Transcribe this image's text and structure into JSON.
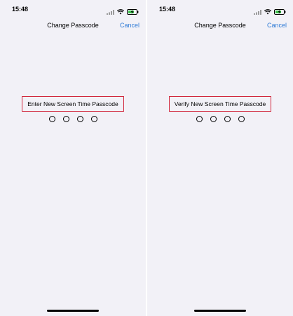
{
  "screens": [
    {
      "status_time": "15:48",
      "nav_title": "Change Passcode",
      "cancel_label": "Cancel",
      "prompt": "Enter New Screen Time Passcode",
      "passcode_dots_filled": 0,
      "passcode_length": 4
    },
    {
      "status_time": "15:48",
      "nav_title": "Change Passcode",
      "cancel_label": "Cancel",
      "prompt": "Verify New Screen Time Passcode",
      "passcode_dots_filled": 0,
      "passcode_length": 4
    }
  ],
  "icons": {
    "signal": "signal-icon",
    "wifi": "wifi-icon",
    "battery": "battery-charging-icon"
  },
  "colors": {
    "background": "#f2f1f7",
    "accent": "#2f7bd6",
    "highlight_border": "#d0243a"
  }
}
